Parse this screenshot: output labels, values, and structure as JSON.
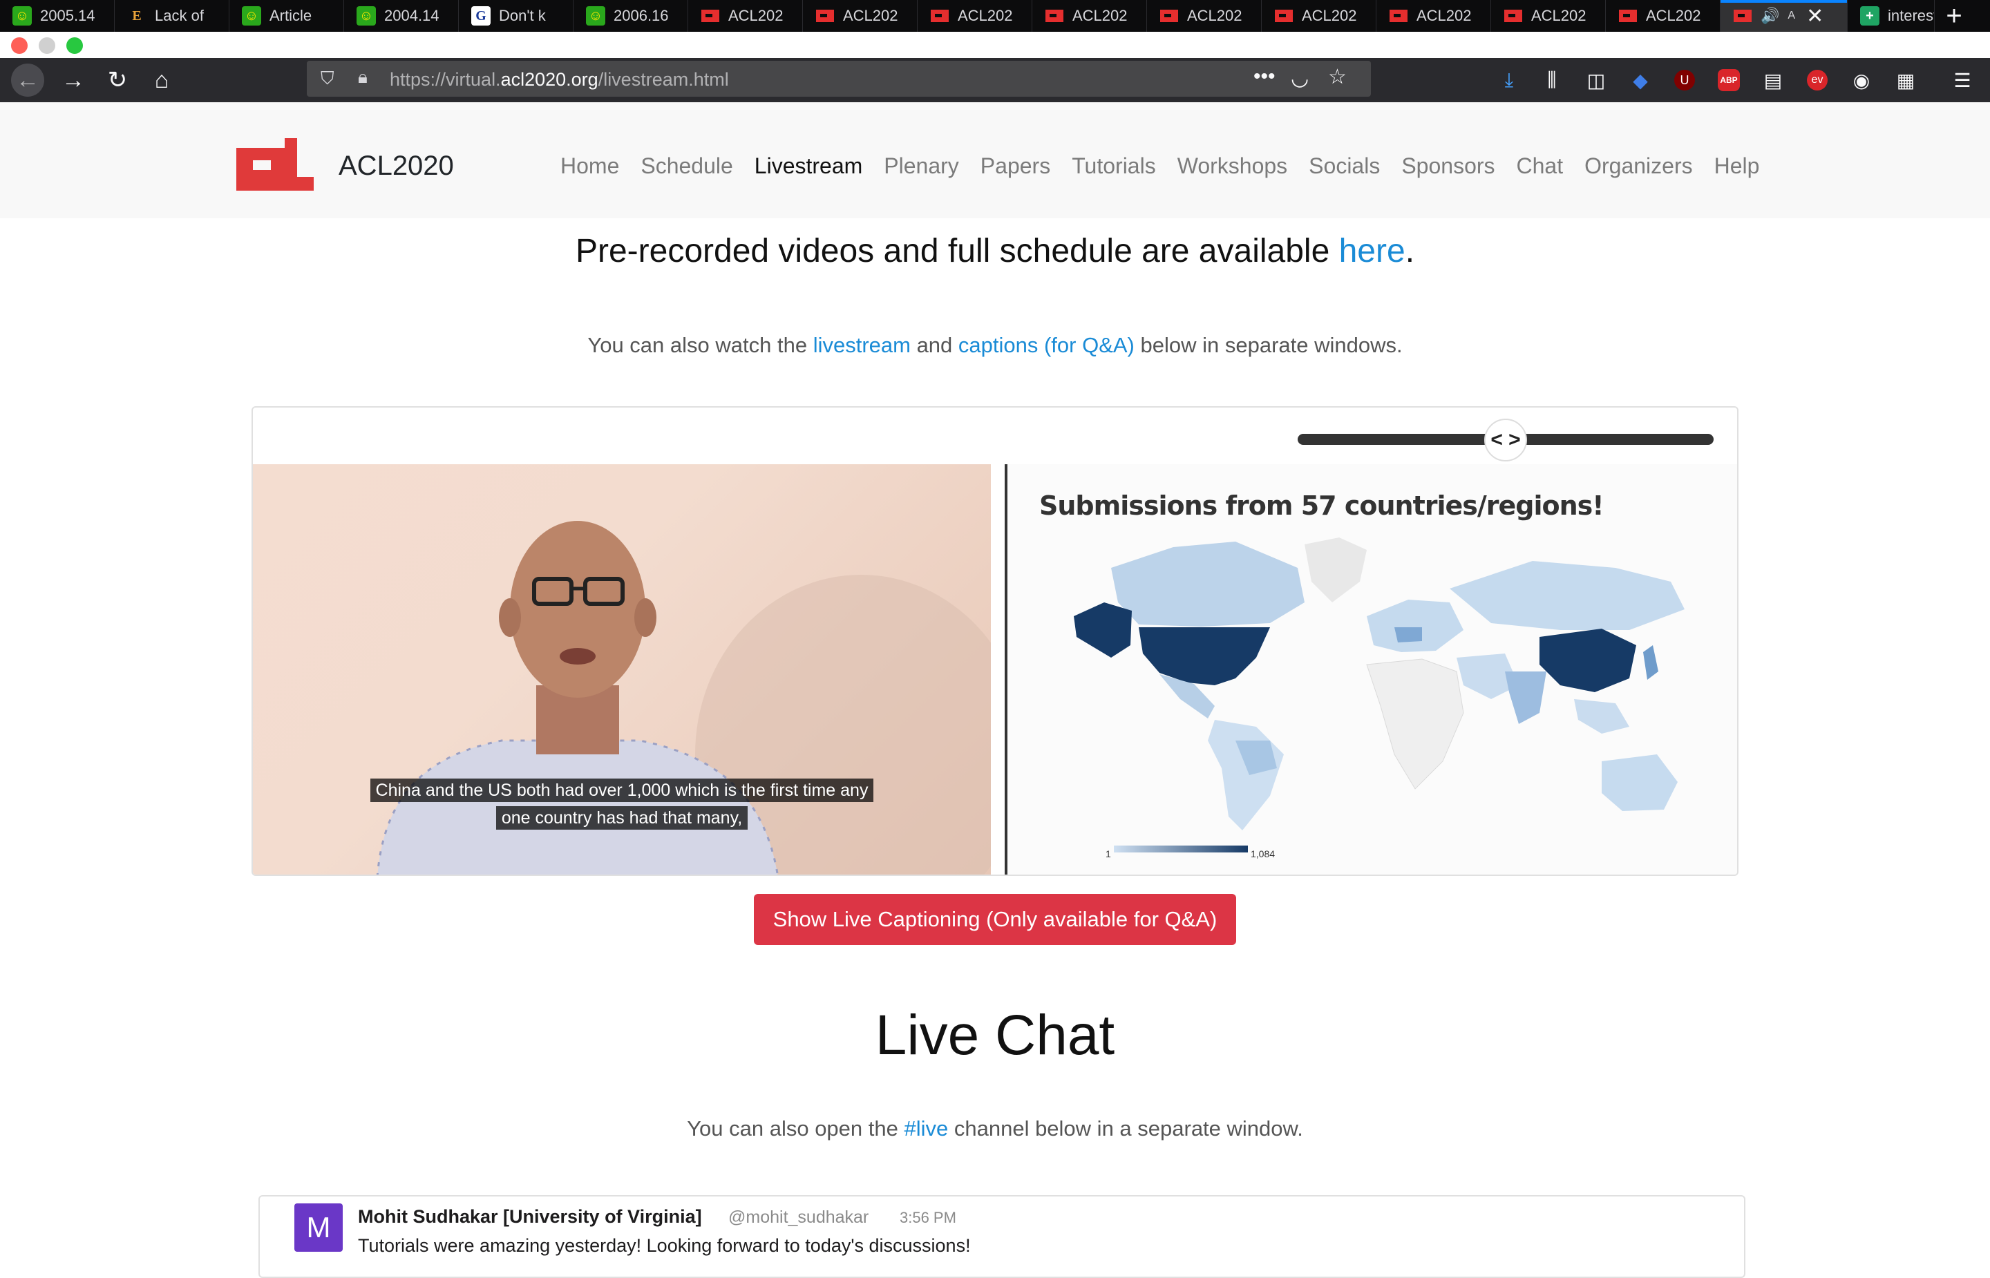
{
  "browser": {
    "tabs": [
      {
        "title": "2005.14",
        "icon": "smiley-icon"
      },
      {
        "title": "Lack of",
        "icon": "e-letter-icon"
      },
      {
        "title": "Article",
        "icon": "smiley-icon"
      },
      {
        "title": "2004.14",
        "icon": "smiley-icon"
      },
      {
        "title": "Don't k",
        "icon": "g-letter-icon"
      },
      {
        "title": "2006.16",
        "icon": "smiley-icon"
      },
      {
        "title": "ACL202",
        "icon": "acl-icon"
      },
      {
        "title": "ACL202",
        "icon": "acl-icon"
      },
      {
        "title": "ACL202",
        "icon": "acl-icon"
      },
      {
        "title": "ACL202",
        "icon": "acl-icon"
      },
      {
        "title": "ACL202",
        "icon": "acl-icon"
      },
      {
        "title": "ACL202",
        "icon": "acl-icon"
      },
      {
        "title": "ACL202",
        "icon": "acl-icon"
      },
      {
        "title": "ACL202",
        "icon": "acl-icon"
      },
      {
        "title": "ACL202",
        "icon": "acl-icon"
      }
    ],
    "active_tab_title": "A",
    "last_tab_title": "interest",
    "url_prefix": "https://virtual.",
    "url_domain": "acl2020.org",
    "url_path": "/livestream.html",
    "accent_color": "#0a84ff"
  },
  "site": {
    "brand": "ACL2020",
    "logo_color": "#e03a3a",
    "nav": [
      "Home",
      "Schedule",
      "Livestream",
      "Plenary",
      "Papers",
      "Tutorials",
      "Workshops",
      "Socials",
      "Sponsors",
      "Chat",
      "Organizers",
      "Help"
    ],
    "active_nav": "Livestream"
  },
  "content": {
    "headline_text": "Pre-recorded videos and full schedule are available ",
    "headline_link": "here",
    "headline_end": ".",
    "sub_pre": "You can also watch the ",
    "sub_link1": "livestream",
    "sub_mid": " and ",
    "sub_link2": "captions (for Q&A)",
    "sub_post": " below in separate windows.",
    "link_color": "#1a8bd6"
  },
  "player": {
    "caption_line1": "China and the US both had over 1,000 which is the first time any",
    "caption_line2": "one country has had that many,",
    "slide_title": "Submissions from 57 countries/regions!",
    "legend_min": "1",
    "legend_max": "1,084",
    "split_handle": "< >"
  },
  "caption_button": "Show Live Captioning (Only available for Q&A)",
  "chat": {
    "title": "Live Chat",
    "sub_pre": "You can also open the ",
    "sub_link": "#live",
    "sub_post": " channel below in a separate window.",
    "message": {
      "avatar_letter": "M",
      "author": "Mohit Sudhakar [University of Virginia]",
      "handle": "@mohit_sudhakar",
      "time": "3:56 PM",
      "text": "Tutorials were amazing yesterday! Looking forward to today's discussions!"
    }
  }
}
